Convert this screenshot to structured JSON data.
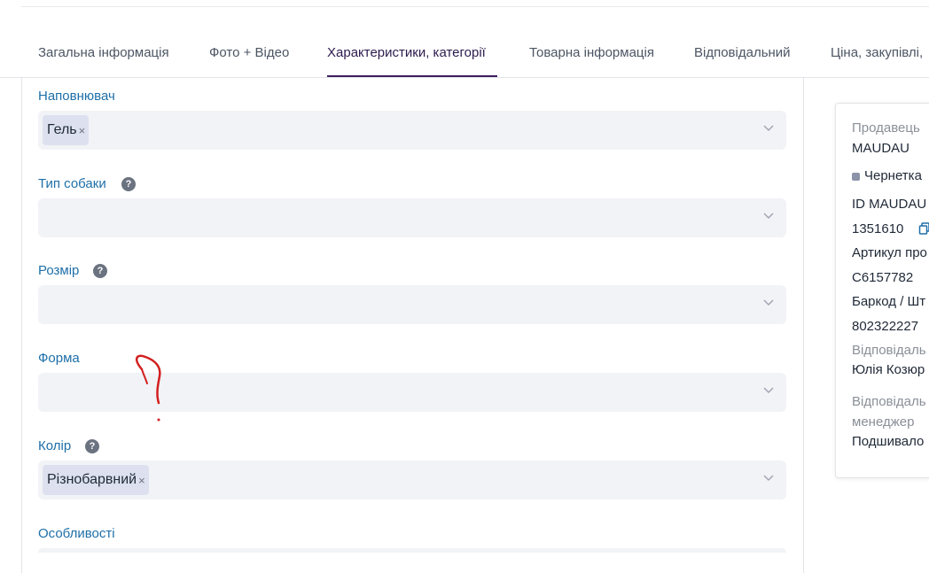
{
  "tabs": [
    {
      "label": "Загальна інформація",
      "active": false
    },
    {
      "label": "Фото + Відео",
      "active": false
    },
    {
      "label": "Характеристики, категорії",
      "active": true
    },
    {
      "label": "Товарна інформація",
      "active": false
    },
    {
      "label": "Відповідальний",
      "active": false
    },
    {
      "label": "Ціна, закупівлі,",
      "active": false
    }
  ],
  "fields": {
    "filler": {
      "label": "Наповнювач",
      "tags": [
        "Гель"
      ]
    },
    "dog_type": {
      "label": "Тип собаки",
      "help": "?"
    },
    "size": {
      "label": "Розмір",
      "help": "?"
    },
    "shape": {
      "label": "Форма"
    },
    "color": {
      "label": "Колір",
      "help": "?",
      "tags": [
        "Різнобарвний"
      ]
    },
    "features": {
      "label": "Особливості"
    }
  },
  "tag_remove_symbol": "×",
  "sidebar_card": {
    "seller_label": "Продавець",
    "seller_value": "MAUDAU",
    "status": "Чернетка",
    "status_color": "#8a93a8",
    "id_label": "ID MAUDAU",
    "id_value": "1351610",
    "article_label": "Артикул про",
    "article_value": "C6157782",
    "barcode_label": "Баркод / Шт",
    "barcode_value": "802322227",
    "responsible_label": "Відповідаль",
    "responsible_value": "Юлія Козюр",
    "manager_label_1": "Відповідаль",
    "manager_label_2": "менеджер",
    "manager_value": "Подшивало"
  },
  "colors": {
    "accent": "#3b2061",
    "label_blue": "#1e6fa8",
    "field_bg": "#f2f3f6",
    "tag_bg": "#dde1ef",
    "annotation_red": "#d21f1f"
  },
  "icons": {
    "help": "question-circle-icon",
    "chevron": "chevron-down-icon",
    "copy": "copy-icon"
  }
}
